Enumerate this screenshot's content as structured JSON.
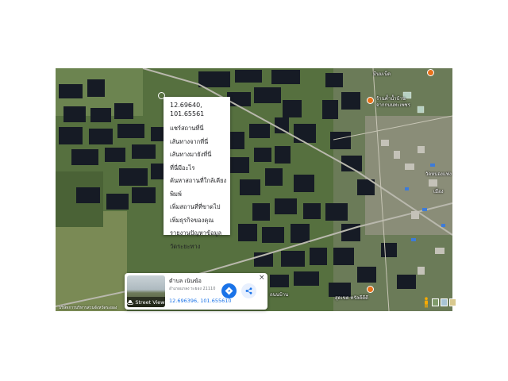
{
  "context_menu": {
    "coords": "12.69640, 101.65561",
    "items": [
      "แชร์สถานที่นี่",
      "เส้นทางจากที่นี่",
      "เส้นทางมายังที่นี่",
      "ที่นี่มีอะไร",
      "ค้นหาสถานที่ใกล้เคียง",
      "พิมพ์",
      "เพิ่มสถานที่ที่ขาดไป",
      "เพิ่มธุรกิจของคุณ",
      "รายงานปัญหาข้อมูล",
      "วัดระยะทาง"
    ]
  },
  "info_card": {
    "title": "ตำบล เนินฆ้อ",
    "subtitle": "อำเภอแกลง ระยอง 21110",
    "coords": "12.696396, 101.655610",
    "street_view_label": "Street View",
    "close_label": "×"
  },
  "map_labels": {
    "top_right_poi": "มีนมเน็ต",
    "mid_right_poi_line1": "ร้านค้ำน้ำบ้าน",
    "mid_right_poi_line2": "จากกนนทะเพชร",
    "right_edge": "วัดหนองแฟง",
    "right_edge2": "เมือง",
    "bottom_road": "ถนนบ้าน",
    "bottom_poi": "สุดเขต ทรัลดีดีดี",
    "attribution": "บริษัทการบริหารส่วนจังหวัดระยอง"
  },
  "icons": {
    "directions": "directions-icon",
    "share": "share-icon",
    "street_view": "street-view-icon",
    "pegman": "pegman-icon"
  },
  "colors": {
    "accent": "#1a73e8",
    "poi": "#e8711a",
    "pond": "#151a24",
    "vegetation": "#4f6a3a"
  }
}
